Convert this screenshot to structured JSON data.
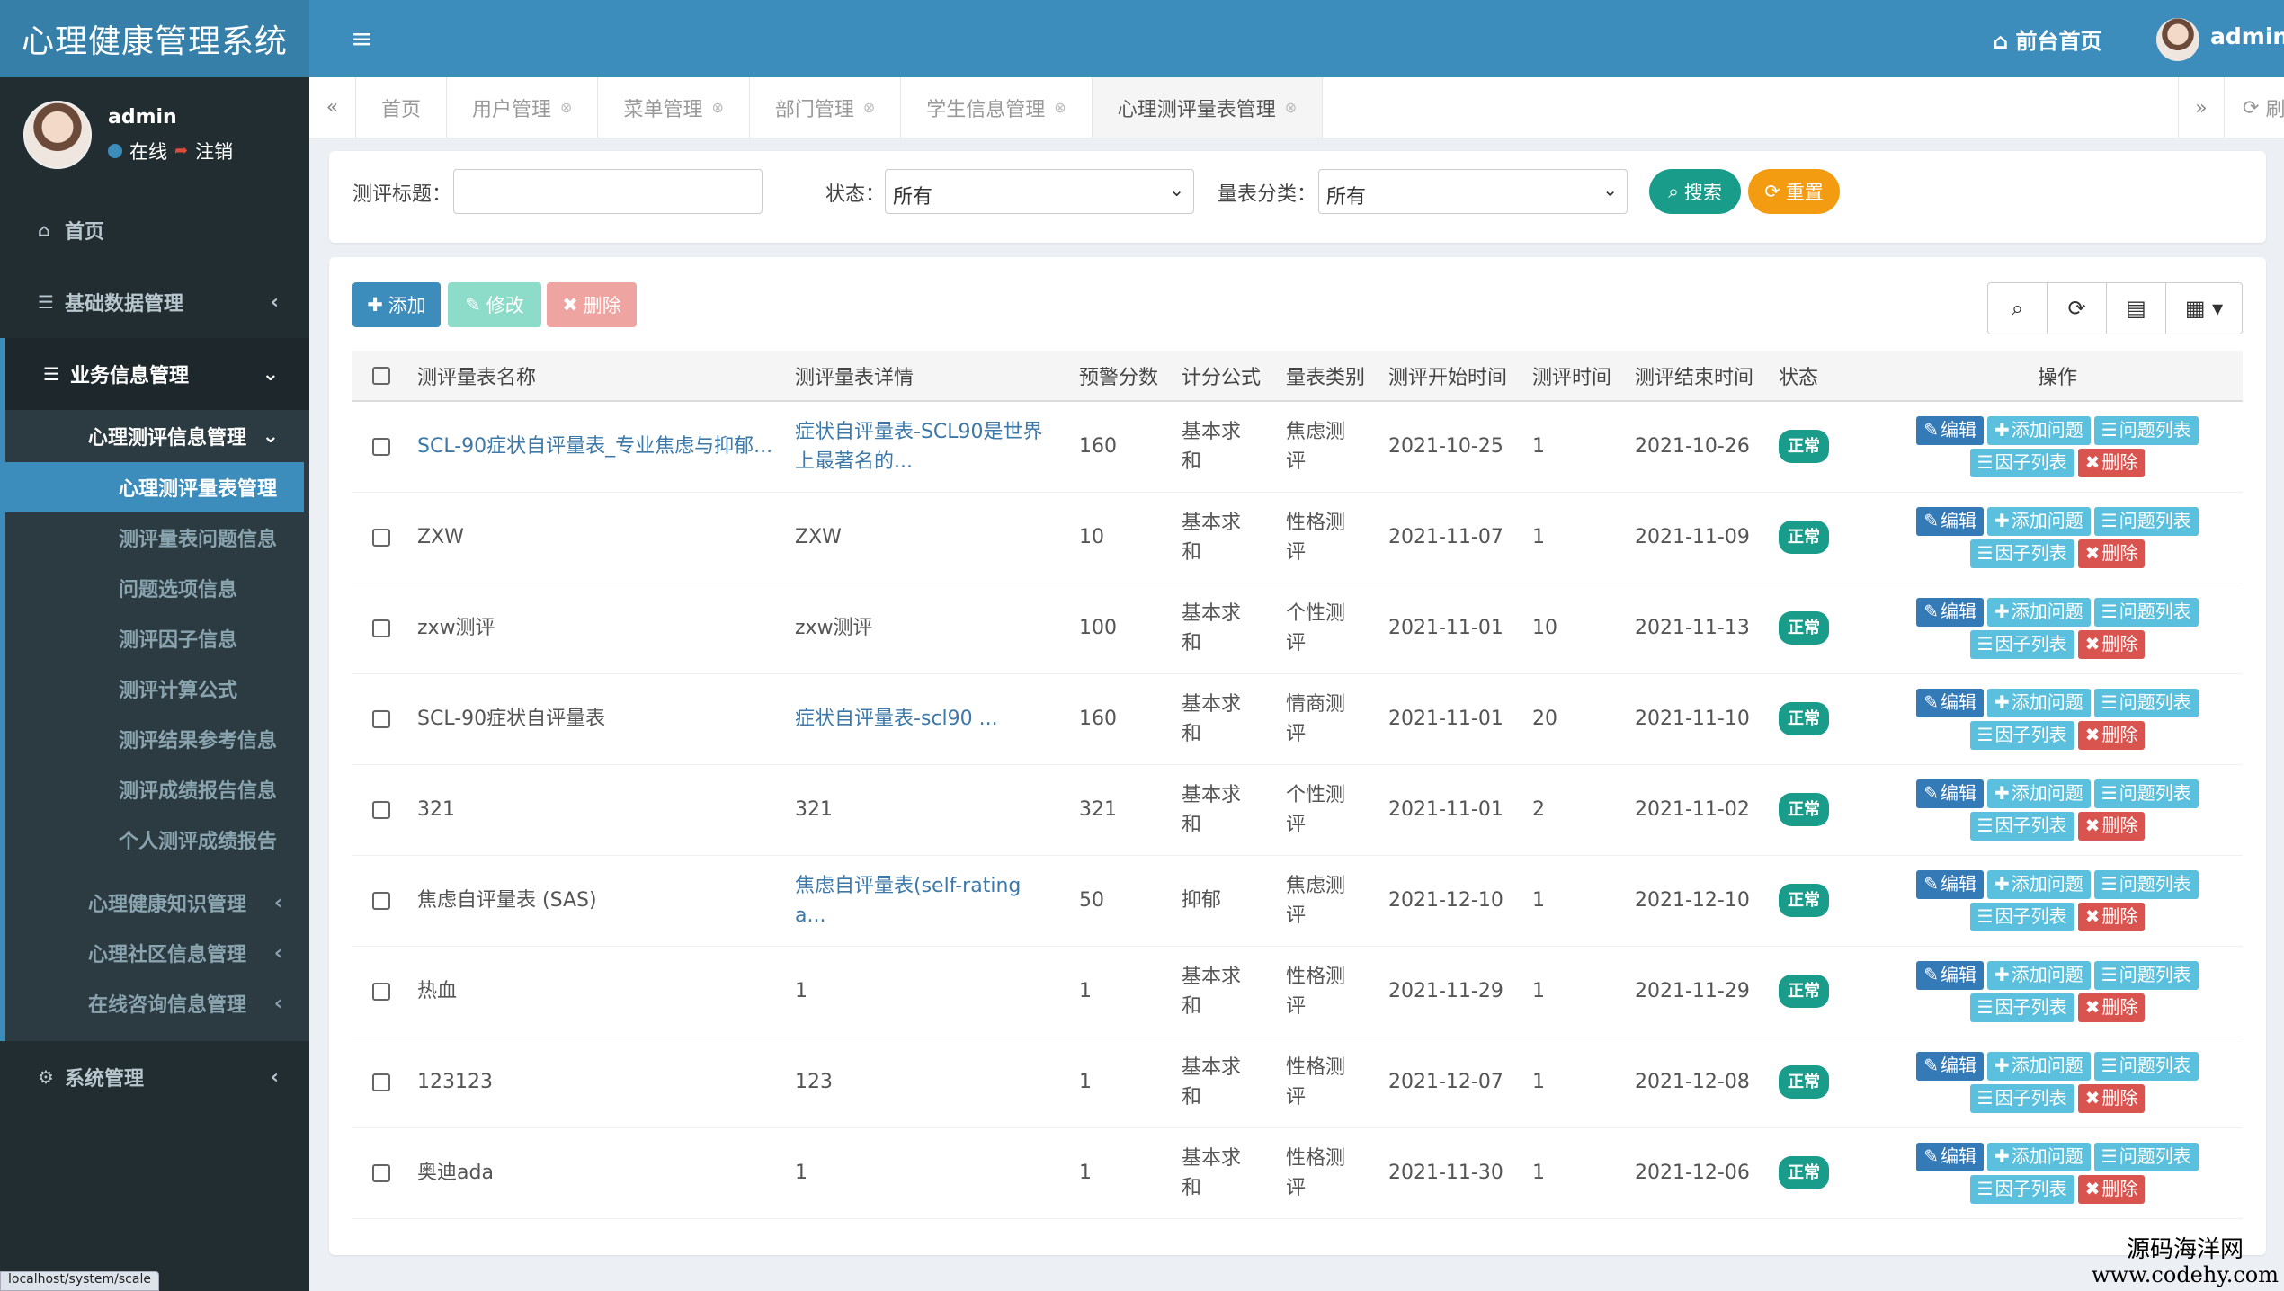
{
  "app": {
    "title": "心理健康管理系统"
  },
  "user": {
    "name": "admin",
    "status": "在线",
    "logout": "注销"
  },
  "header": {
    "front_link": "前台首页",
    "username": "admin"
  },
  "sidebar": {
    "home": "首页",
    "basic": "基础数据管理",
    "business": "业务信息管理",
    "eval_group": "心理测评信息管理",
    "eval_items": [
      "心理测评量表管理",
      "测评量表问题信息",
      "问题选项信息",
      "测评因子信息",
      "测评计算公式",
      "测评结果参考信息",
      "测评成绩报告信息",
      "个人测评成绩报告"
    ],
    "knowledge": "心理健康知识管理",
    "community": "心理社区信息管理",
    "consult": "在线咨询信息管理",
    "system": "系统管理"
  },
  "tabs": {
    "items": [
      "首页",
      "用户管理",
      "菜单管理",
      "部门管理",
      "学生信息管理",
      "心理测评量表管理"
    ],
    "refresh": "刷新"
  },
  "search": {
    "title_label": "测评标题：",
    "title_value": "",
    "status_label": "状态：",
    "status_value": "所有",
    "category_label": "量表分类：",
    "category_value": "所有",
    "search_btn": "搜索",
    "reset_btn": "重置"
  },
  "toolbar": {
    "add": "添加",
    "edit": "修改",
    "delete": "删除"
  },
  "table": {
    "headers": [
      "测评量表名称",
      "测评量表详情",
      "预警分数",
      "计分公式",
      "量表类别",
      "测评开始时间",
      "测评时间",
      "测评结束时间",
      "状态",
      "操作"
    ],
    "rows": [
      {
        "name": "SCL-90症状自评量表_专业焦虑与抑郁...",
        "name_link": true,
        "detail": "症状自评量表-SCL90是世界上最著名的...",
        "detail_link": true,
        "score": "160",
        "formula": "基本求和",
        "category": "焦虑测评",
        "start": "2021-10-25",
        "duration": "1",
        "end": "2021-10-26",
        "status": "正常"
      },
      {
        "name": "ZXW",
        "name_link": false,
        "detail": "ZXW",
        "detail_link": false,
        "score": "10",
        "formula": "基本求和",
        "category": "性格测评",
        "start": "2021-11-07",
        "duration": "1",
        "end": "2021-11-09",
        "status": "正常"
      },
      {
        "name": "zxw测评",
        "name_link": false,
        "detail": "zxw测评",
        "detail_link": false,
        "score": "100",
        "formula": "基本求和",
        "category": "个性测评",
        "start": "2021-11-01",
        "duration": "10",
        "end": "2021-11-13",
        "status": "正常"
      },
      {
        "name": "SCL-90症状自评量表",
        "name_link": false,
        "detail": "症状自评量表-scl90 ...",
        "detail_link": true,
        "score": "160",
        "formula": "基本求和",
        "category": "情商测评",
        "start": "2021-11-01",
        "duration": "20",
        "end": "2021-11-10",
        "status": "正常"
      },
      {
        "name": "321",
        "name_link": false,
        "detail": "321",
        "detail_link": false,
        "score": "321",
        "formula": "基本求和",
        "category": "个性测评",
        "start": "2021-11-01",
        "duration": "2",
        "end": "2021-11-02",
        "status": "正常"
      },
      {
        "name": "焦虑自评量表 (SAS)",
        "name_link": false,
        "detail": "焦虑自评量表(self-rating a...",
        "detail_link": true,
        "score": "50",
        "formula": "抑郁",
        "category": "焦虑测评",
        "start": "2021-12-10",
        "duration": "1",
        "end": "2021-12-10",
        "status": "正常"
      },
      {
        "name": "热血",
        "name_link": false,
        "detail": "1",
        "detail_link": false,
        "score": "1",
        "formula": "基本求和",
        "category": "性格测评",
        "start": "2021-11-29",
        "duration": "1",
        "end": "2021-11-29",
        "status": "正常"
      },
      {
        "name": "123123",
        "name_link": false,
        "detail": "123",
        "detail_link": false,
        "score": "1",
        "formula": "基本求和",
        "category": "性格测评",
        "start": "2021-12-07",
        "duration": "1",
        "end": "2021-12-08",
        "status": "正常"
      },
      {
        "name": "奥迪ada",
        "name_link": false,
        "detail": "1",
        "detail_link": false,
        "score": "1",
        "formula": "基本求和",
        "category": "性格测评",
        "start": "2021-11-30",
        "duration": "1",
        "end": "2021-12-06",
        "status": "正常"
      }
    ],
    "ops": {
      "edit": "编辑",
      "add_q": "添加问题",
      "q_list": "问题列表",
      "factor_list": "因子列表",
      "delete": "删除"
    }
  },
  "statusbar": {
    "url": "localhost/system/scale"
  },
  "watermark": {
    "line1": "源码海洋网",
    "line2": "www.codehy.com"
  },
  "colors": {
    "header": "#3c8dbc",
    "logo": "#367fa9",
    "sidebar": "#222d32",
    "success": "#1a9c8a",
    "danger": "#d9534f",
    "info": "#5bc0de",
    "primary": "#337ab7"
  }
}
